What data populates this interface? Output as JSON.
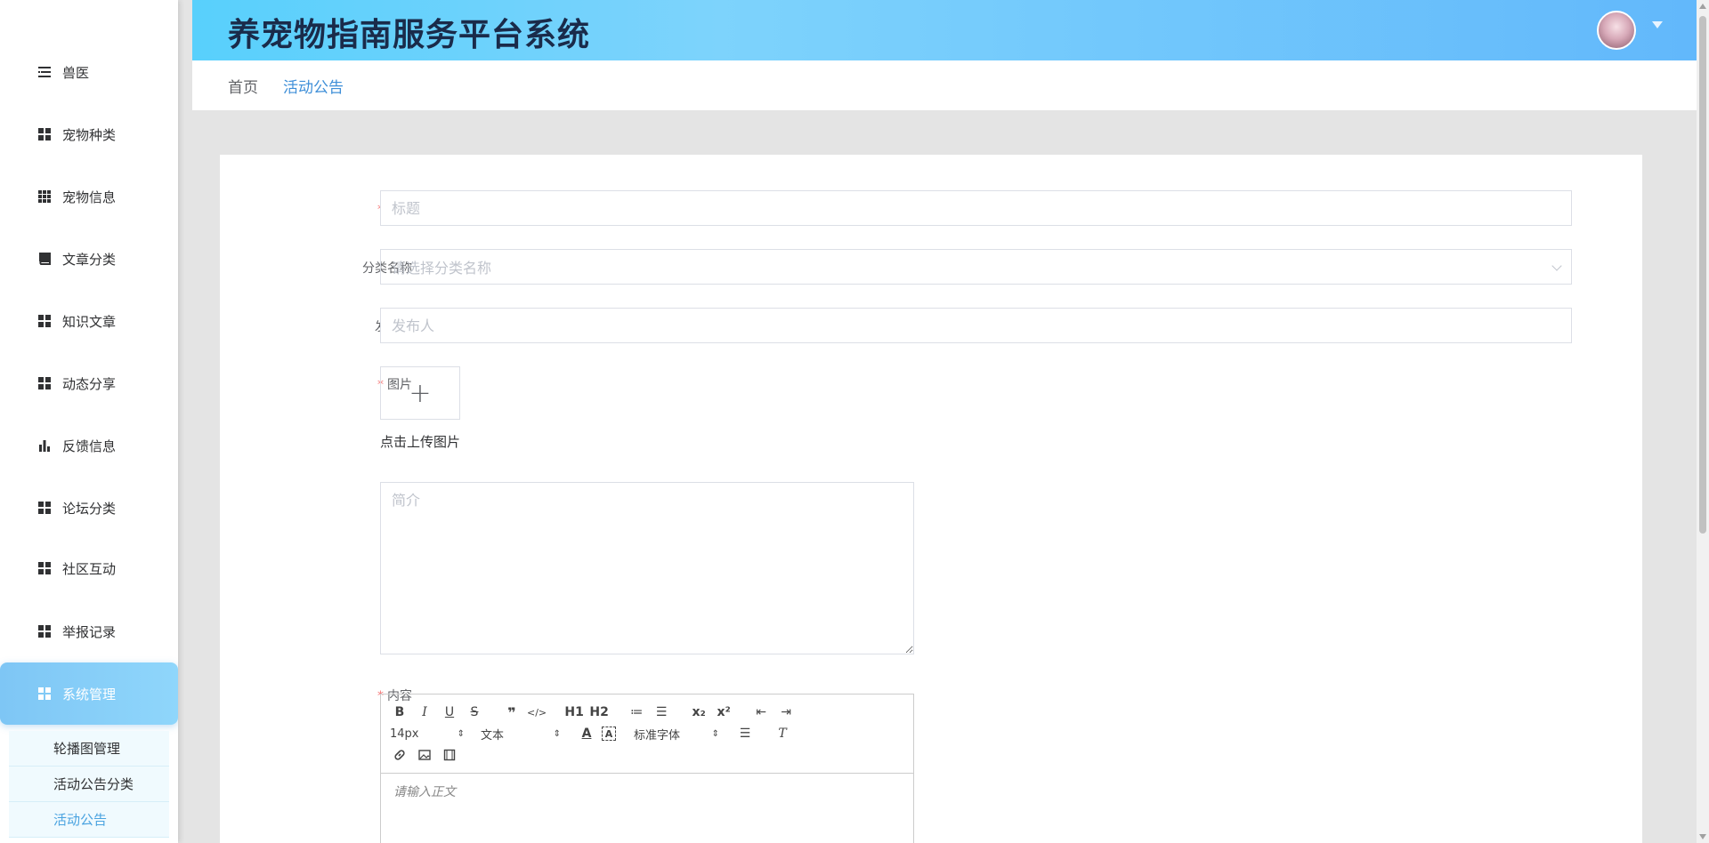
{
  "app": {
    "title": "养宠物指南服务平台系统"
  },
  "sidebar": {
    "items": [
      {
        "label": "兽医",
        "icon": "list-icon"
      },
      {
        "label": "宠物种类",
        "icon": "grid-icon"
      },
      {
        "label": "宠物信息",
        "icon": "apps-icon"
      },
      {
        "label": "文章分类",
        "icon": "book-icon"
      },
      {
        "label": "知识文章",
        "icon": "grid-icon"
      },
      {
        "label": "动态分享",
        "icon": "grid-icon"
      },
      {
        "label": "反馈信息",
        "icon": "bar-chart-icon"
      },
      {
        "label": "论坛分类",
        "icon": "grid-icon"
      },
      {
        "label": "社区互动",
        "icon": "grid-icon"
      },
      {
        "label": "举报记录",
        "icon": "grid-icon"
      },
      {
        "label": "系统管理",
        "icon": "grid-icon"
      }
    ],
    "submenu": [
      {
        "label": "轮播图管理"
      },
      {
        "label": "活动公告分类"
      },
      {
        "label": "活动公告"
      }
    ]
  },
  "breadcrumb": {
    "home": "首页",
    "current": "活动公告"
  },
  "form": {
    "title_label": "标题",
    "title_placeholder": "标题",
    "category_label": "分类名称",
    "category_placeholder": "请选择分类名称",
    "publisher_label": "发布人",
    "publisher_placeholder": "发布人",
    "image_label": "图片",
    "upload_plus": "+",
    "upload_tip": "点击上传图片",
    "intro_label": "简介",
    "intro_placeholder": "简介",
    "content_label": "内容",
    "required_mark": "*"
  },
  "editor": {
    "row1": [
      "B",
      "I",
      "U",
      "S",
      "❞",
      "</>",
      "H1",
      "H2",
      "≔",
      "☰",
      "x₂",
      "x²",
      "⇤",
      "⇥"
    ],
    "font_size": "14px",
    "header_select": "文本",
    "font_family": "标准字体",
    "placeholder": "请输入正文"
  },
  "colors": {
    "accent": "#3f8fd8",
    "required": "#f56c6c",
    "header_start": "#58d0fc",
    "header_end": "#62b8fb"
  }
}
